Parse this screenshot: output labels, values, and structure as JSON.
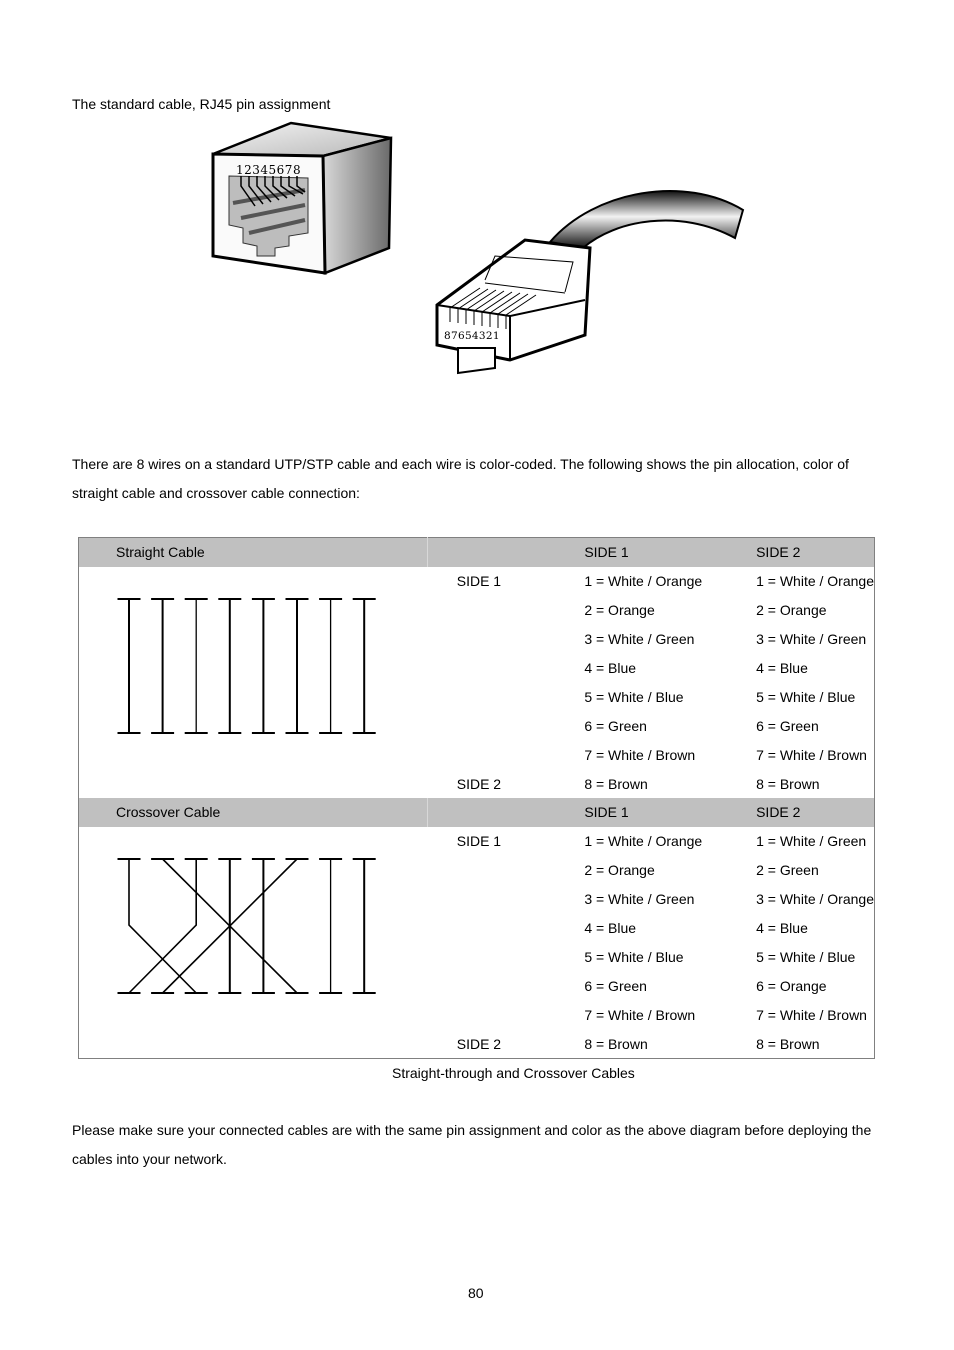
{
  "intro_title": "The standard cable, RJ45 pin assignment",
  "figures": {
    "jack_pin_labels": "12345678",
    "plug_pin_labels": "87654321"
  },
  "paragraph_1": "There are 8 wires on a standard UTP/STP cable and each wire is color-coded. The following shows the pin allocation, color of straight cable and crossover cable connection:",
  "table": {
    "straight": {
      "title": "Straight Cable",
      "col_side1": "SIDE 1",
      "col_side2": "SIDE 2",
      "row_side1_label": "SIDE 1",
      "row_side2_label": "SIDE 2",
      "side1": [
        "1 = White / Orange",
        "2 = Orange",
        "3 = White / Green",
        "4 = Blue",
        "5 = White / Blue",
        "6 = Green",
        "7 = White / Brown",
        "8 = Brown"
      ],
      "side2": [
        "1 = White / Orange",
        "2 = Orange",
        "3 = White / Green",
        "4 = Blue",
        "5 = White / Blue",
        "6 = Green",
        "7 = White / Brown",
        "8 = Brown"
      ],
      "wiring": [
        1,
        2,
        3,
        4,
        5,
        6,
        7,
        8
      ]
    },
    "crossover": {
      "title": "Crossover Cable",
      "col_side1": "SIDE 1",
      "col_side2": "SIDE 2",
      "row_side1_label": "SIDE 1",
      "row_side2_label": "SIDE 2",
      "side1": [
        "1 = White / Orange",
        "2 = Orange",
        "3 = White / Green",
        "4 = Blue",
        "5 = White / Blue",
        "6 = Green",
        "7 = White / Brown",
        "8 = Brown"
      ],
      "side2": [
        "1 = White / Green",
        "2 = Green",
        "3 = White / Orange",
        "4 = Blue",
        "5 = White / Blue",
        "6 = Orange",
        "7 = White / Brown",
        "8 = Brown"
      ],
      "wiring": [
        3,
        6,
        1,
        4,
        5,
        2,
        7,
        8
      ]
    }
  },
  "caption": "Straight-through and Crossover Cables",
  "paragraph_2": "Please make sure your connected cables are with the same pin assignment and color as the above diagram before deploying the cables into your network.",
  "page_number": "80"
}
